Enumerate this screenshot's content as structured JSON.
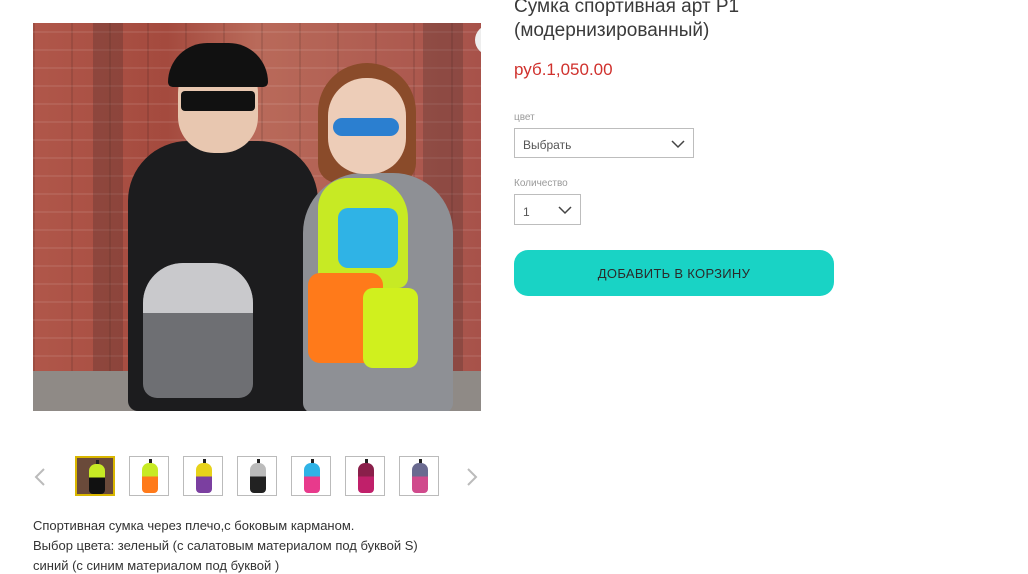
{
  "product": {
    "title": "Сумка спортивная арт Р1 (модернизированный)",
    "price": "руб.1,050.00"
  },
  "options": {
    "color_label": "цвет",
    "color_value": "Выбрать",
    "quantity_label": "Количество",
    "quantity_value": "1"
  },
  "actions": {
    "add_to_cart": "ДОБАВИТЬ В КОРЗИНУ"
  },
  "gallery": {
    "zoom_icon": "zoom-icon",
    "thumbnails": [
      {
        "colors": [
          "#111111",
          "#c7ea24"
        ],
        "selected": true
      },
      {
        "colors": [
          "#ff7a1a",
          "#c7ea24"
        ],
        "selected": false
      },
      {
        "colors": [
          "#7b3fa0",
          "#e7d21a"
        ],
        "selected": false
      },
      {
        "colors": [
          "#222222",
          "#bbbbbb"
        ],
        "selected": false
      },
      {
        "colors": [
          "#e83a8c",
          "#2fb3e6"
        ],
        "selected": false
      },
      {
        "colors": [
          "#c0206a",
          "#8a1f4a"
        ],
        "selected": false
      },
      {
        "colors": [
          "#d04a8c",
          "#6a6a90"
        ],
        "selected": false
      }
    ]
  },
  "description": {
    "line1": "Спортивная сумка через плечо,с боковым карманом.",
    "line2": "Выбор цвета: зеленый (с салатовым материалом под буквой S)",
    "line3": "синий (с синим материалом под буквой )"
  },
  "colors": {
    "accent_button": "#19d3c5",
    "price": "#d0312d",
    "thumb_selected": "#d9b600"
  }
}
